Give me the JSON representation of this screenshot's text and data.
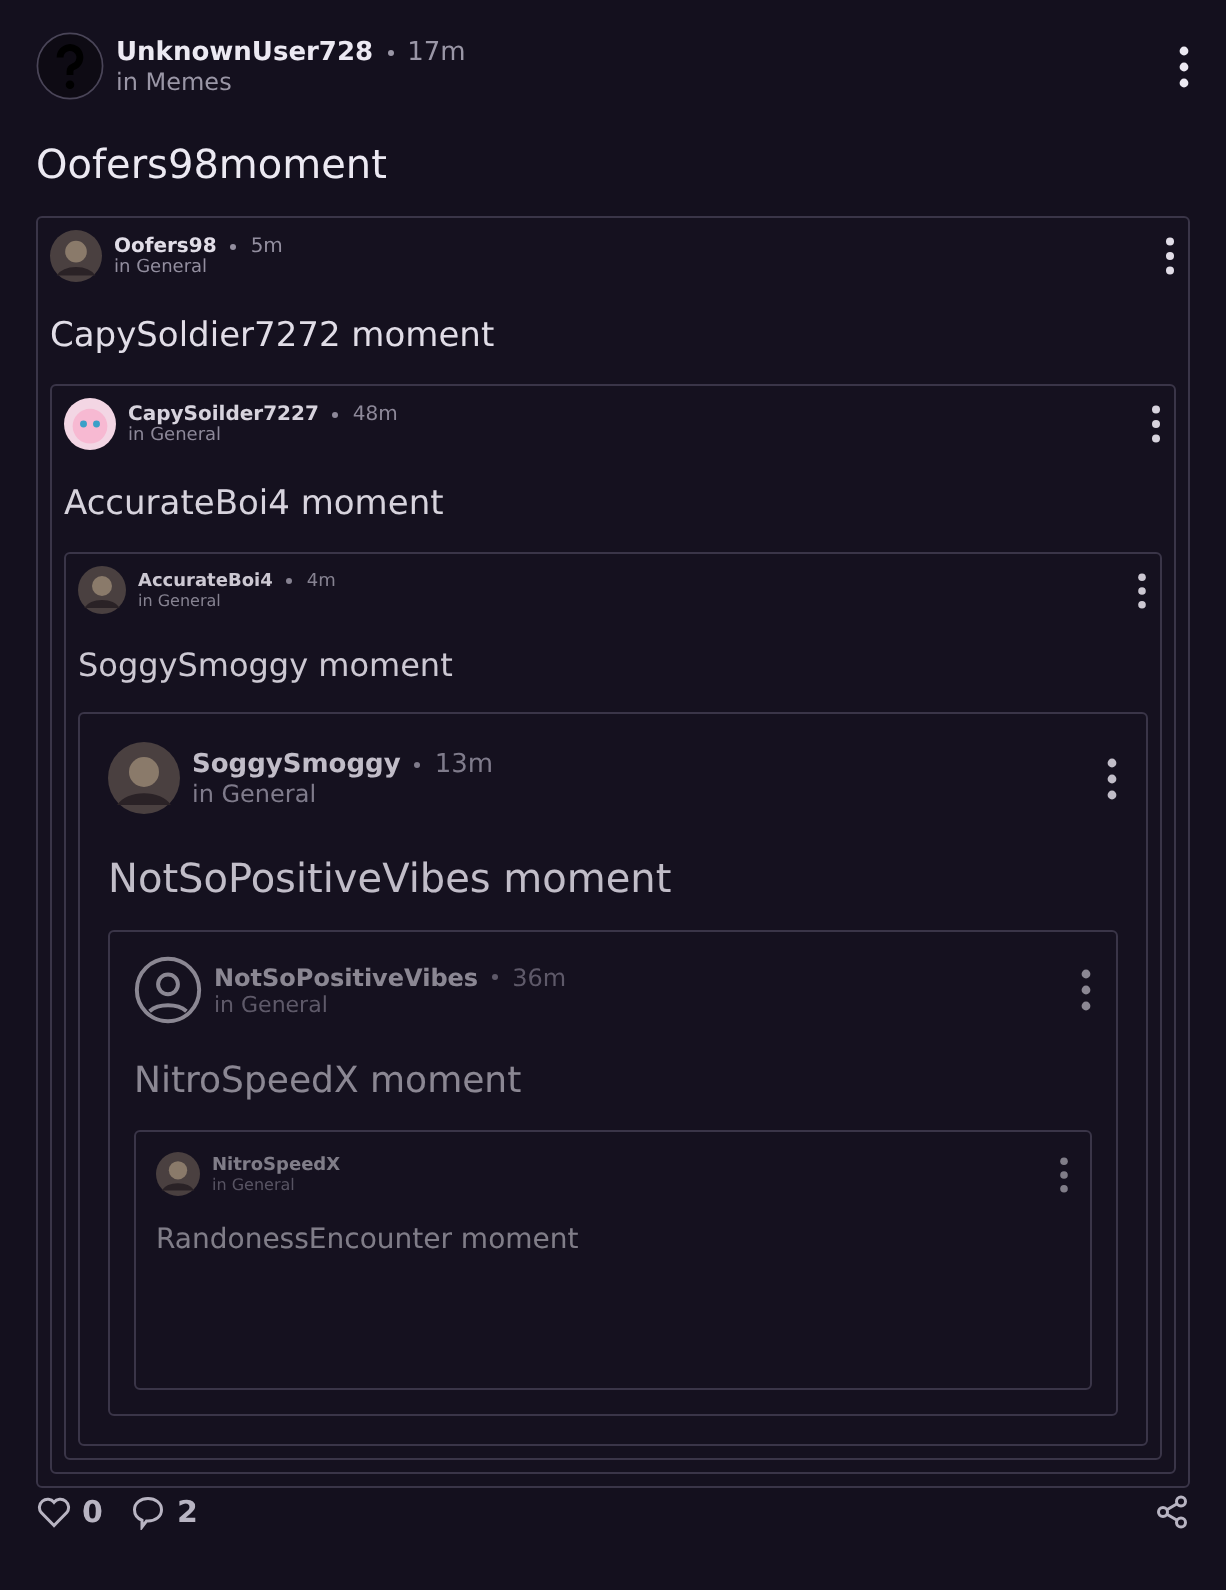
{
  "post": {
    "author": "UnknownUser728",
    "time": "17m",
    "community": "in Memes",
    "avatar": {
      "kind": "question"
    },
    "text": "Oofers98moment",
    "embed": {
      "author": "Oofers98",
      "time": "5m",
      "community": "in General",
      "avatar": {
        "kind": "photo"
      },
      "text": "CapySoldier7272 moment",
      "embed": {
        "author": "CapySoilder7227",
        "time": "48m",
        "community": "in General",
        "avatar": {
          "kind": "pink"
        },
        "text": "AccurateBoi4 moment",
        "embed": {
          "author": "AccurateBoi4",
          "time": "4m",
          "community": "in General",
          "avatar": {
            "kind": "photo"
          },
          "text": "SoggySmoggy moment",
          "embed": {
            "author": "SoggySmoggy",
            "time": "13m",
            "community": "in General",
            "avatar": {
              "kind": "photo"
            },
            "text": "NotSoPositiveVibes moment",
            "embed": {
              "author": "NotSoPositiveVibes",
              "time": "36m",
              "community": "in General",
              "avatar": {
                "kind": "outline"
              },
              "text": "NitroSpeedX moment",
              "embed": {
                "author": "NitroSpeedX",
                "community": "in General",
                "avatar": {
                  "kind": "photo"
                },
                "text": "RandonessEncounter moment"
              }
            }
          }
        }
      }
    }
  },
  "footer": {
    "likes": "0",
    "comments": "2"
  }
}
